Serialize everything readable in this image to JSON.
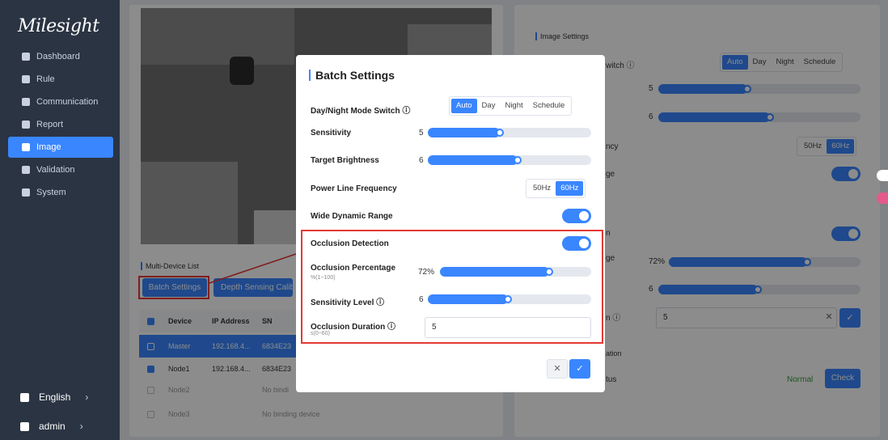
{
  "app": {
    "logo": "Milesight"
  },
  "sidebar": {
    "items": [
      {
        "label": "Dashboard",
        "icon": "dashboard-icon"
      },
      {
        "label": "Rule",
        "icon": "rule-icon"
      },
      {
        "label": "Communication",
        "icon": "communication-icon"
      },
      {
        "label": "Report",
        "icon": "report-icon"
      },
      {
        "label": "Image",
        "icon": "image-icon",
        "active": true
      },
      {
        "label": "Validation",
        "icon": "validation-icon"
      },
      {
        "label": "System",
        "icon": "gear-icon"
      }
    ],
    "language": "English",
    "user": "admin"
  },
  "left": {
    "list_title": "Multi-Device List",
    "batch_button": "Batch Settings",
    "depth_button": "Depth Sensing Calib",
    "table": {
      "headers": [
        "Device",
        "IP Address",
        "SN"
      ],
      "rows": [
        {
          "device": "Master",
          "ip": "192.168.4...",
          "sn": "6834E23",
          "checked": true
        },
        {
          "device": "Node1",
          "ip": "192.168.4...",
          "sn": "6834E23",
          "checked": true
        },
        {
          "device": "Node2",
          "ip": "",
          "sn": "No bindi",
          "checked": false
        },
        {
          "device": "Node3",
          "ip": "",
          "sn": "No binding device",
          "checked": false
        }
      ]
    }
  },
  "right": {
    "section_title": "Image Settings",
    "switch_label_partial": "witch ⓘ",
    "mode_options": [
      "Auto",
      "Day",
      "Night",
      "Schedule"
    ],
    "sensitivity_value": "5",
    "brightness_value": "6",
    "freq_label_partial": "ncy",
    "freq_options": [
      "50Hz",
      "60Hz"
    ],
    "wdr_label_partial": "ge",
    "occ_label_partial": "n",
    "pct_label_partial": "ge",
    "pct_value": "72%",
    "level_value": "6",
    "dur_label_partial": "n ⓘ",
    "dur_value": "5",
    "cal_label_partial": "ation",
    "status_label_partial": "tus",
    "status_value": "Normal",
    "check_button": "Check"
  },
  "modal": {
    "title": "Batch Settings",
    "mode_label": "Day/Night Mode Switch ⓘ",
    "mode_options": [
      "Auto",
      "Day",
      "Night",
      "Schedule"
    ],
    "mode_selected": "Auto",
    "sensitivity_label": "Sensitivity",
    "sensitivity_value": "5",
    "sensitivity_fraction": 0.44,
    "brightness_label": "Target Brightness",
    "brightness_value": "6",
    "brightness_fraction": 0.55,
    "freq_label": "Power Line Frequency",
    "freq_options": [
      "50Hz",
      "60Hz"
    ],
    "freq_selected": "60Hz",
    "wdr_label": "Wide Dynamic Range",
    "wdr_on": true,
    "occ_label": "Occlusion Detection",
    "occ_on": true,
    "pct_label": "Occlusion Percentage",
    "pct_hint": "%(1~100)",
    "pct_value": "72%",
    "pct_fraction": 0.72,
    "level_label": "Sensitivity Level ⓘ",
    "level_value": "6",
    "level_fraction": 0.49,
    "dur_label": "Occlusion Duration ⓘ",
    "dur_hint": "s(0~60)",
    "dur_value": "5",
    "cancel_icon": "close-icon",
    "confirm_icon": "check-icon"
  },
  "colors": {
    "accent": "#3a86ff",
    "sidebar": "#2b3443",
    "highlight": "#e53935",
    "status_ok": "#3a9a3a"
  }
}
